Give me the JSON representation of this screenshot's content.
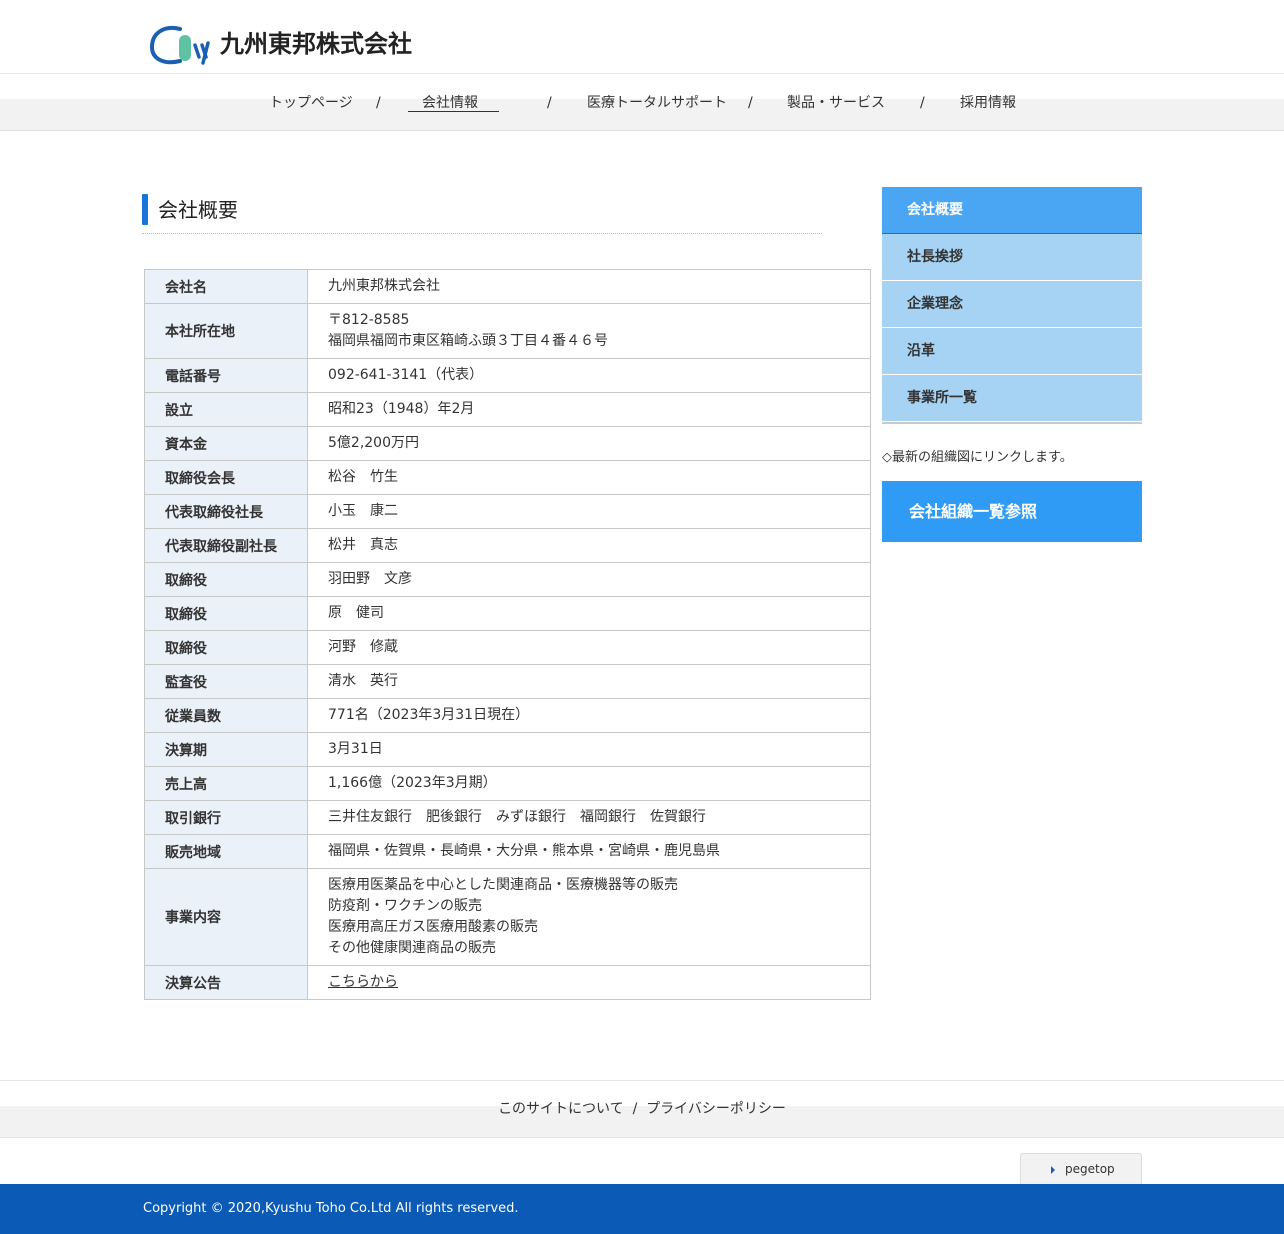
{
  "brand": {
    "company_name": "九州東邦株式会社"
  },
  "nav": {
    "items": [
      "トップページ",
      "会社情報",
      "医療トータルサポート",
      "製品・サービス",
      "採用情報"
    ],
    "active_index": 1,
    "separator": "/"
  },
  "main": {
    "heading": "会社概要",
    "rows": [
      {
        "label": "会社名",
        "lines": [
          "九州東邦株式会社"
        ]
      },
      {
        "label": "本社所在地",
        "lines": [
          "〒812‐8585",
          "福岡県福岡市東区箱崎ふ頭３丁目４番４６号"
        ]
      },
      {
        "label": "電話番号",
        "lines": [
          "092‐641‐3141（代表）"
        ]
      },
      {
        "label": "設立",
        "lines": [
          "昭和23（1948）年2月"
        ]
      },
      {
        "label": "資本金",
        "lines": [
          "5億2,200万円"
        ]
      },
      {
        "label": "取締役会長",
        "lines": [
          "松谷　竹生"
        ]
      },
      {
        "label": "代表取締役社長",
        "lines": [
          "小玉　康二"
        ]
      },
      {
        "label": "代表取締役副社長",
        "lines": [
          "松井　真志"
        ]
      },
      {
        "label": "取締役",
        "lines": [
          "羽田野　文彦"
        ]
      },
      {
        "label": "取締役",
        "lines": [
          "原　健司"
        ]
      },
      {
        "label": "取締役",
        "lines": [
          "河野　修蔵"
        ]
      },
      {
        "label": "監査役",
        "lines": [
          "清水　英行"
        ]
      },
      {
        "label": "従業員数",
        "lines": [
          "771名（2023年3月31日現在）"
        ]
      },
      {
        "label": "決算期",
        "lines": [
          "3月31日"
        ]
      },
      {
        "label": "売上高",
        "lines": [
          "1,166億（2023年3月期）"
        ]
      },
      {
        "label": "取引銀行",
        "lines": [
          "三井住友銀行　肥後銀行　みずほ銀行　福岡銀行　佐賀銀行"
        ]
      },
      {
        "label": "販売地域",
        "lines": [
          "福岡県・佐賀県・長崎県・大分県・熊本県・宮崎県・鹿児島県"
        ]
      },
      {
        "label": "事業内容",
        "lines": [
          "医療用医薬品を中心とした関連商品・医療機器等の販売",
          "防疫剤・ワクチンの販売",
          "医療用高圧ガス医療用酸素の販売",
          "その他健康関連商品の販売"
        ]
      },
      {
        "label": "決算公告",
        "lines": [
          "こちらから"
        ],
        "link": true
      }
    ]
  },
  "side": {
    "menu": [
      "会社概要",
      "社長挨拶",
      "企業理念",
      "沿革",
      "事業所一覧"
    ],
    "active_index": 0,
    "note": "◇最新の組織図にリンクします。",
    "org_button": "会社組織一覧参照"
  },
  "footer": {
    "links": [
      "このサイトについて",
      "プライバシーポリシー"
    ],
    "separator": "/",
    "pagetop": "pegetop",
    "copyright": "Copyright © 2020,Kyushu Toho Co.Ltd All rights reserved."
  },
  "colors": {
    "accent": "#1a73d9",
    "side_active": "#4aa6f2",
    "side_item": "#a6d3f4",
    "org_button": "#2f9bf5",
    "copyright_bar": "#0b5ab5",
    "table_header": "#eaf1f9"
  }
}
